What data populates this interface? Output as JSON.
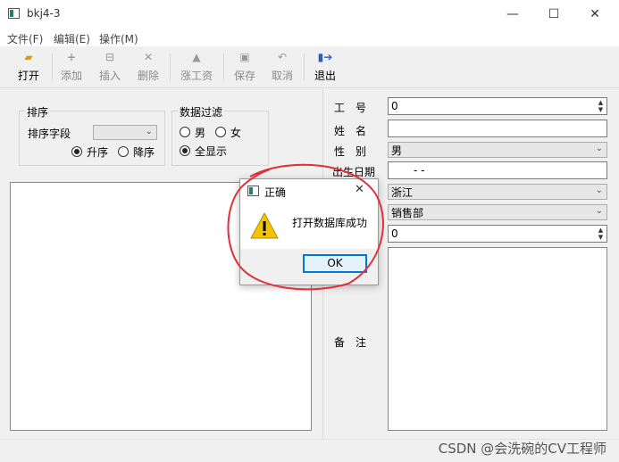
{
  "window": {
    "title": "bkj4-3",
    "minimize_glyph": "—",
    "maximize_glyph": "☐",
    "close_glyph": "✕"
  },
  "menu": [
    {
      "label": "文件(F)"
    },
    {
      "label": "编辑(E)"
    },
    {
      "label": "操作(M)"
    }
  ],
  "toolbar": {
    "open": {
      "label": "打开",
      "icon": "folder-open-icon"
    },
    "add": {
      "label": "添加",
      "icon": "plus-icon"
    },
    "insert": {
      "label": "插入",
      "icon": "insert-row-icon"
    },
    "delete": {
      "label": "删除",
      "icon": "x-icon"
    },
    "raise": {
      "label": "涨工资",
      "icon": "triangle-up-icon"
    },
    "save": {
      "label": "保存",
      "icon": "floppy-icon"
    },
    "cancel": {
      "label": "取消",
      "icon": "undo-icon"
    },
    "exit": {
      "label": "退出",
      "icon": "exit-door-icon"
    }
  },
  "sort": {
    "group_title": "排序",
    "field_label": "排序字段",
    "field_value": "",
    "asc_label": "升序",
    "desc_label": "降序",
    "selected": "asc"
  },
  "filter": {
    "group_title": "数据过滤",
    "male_label": "男",
    "female_label": "女",
    "all_label": "全显示",
    "selected": "all"
  },
  "form": {
    "emp_no_label": "工　号",
    "emp_no_value": "0",
    "name_label": "姓　名",
    "name_value": "",
    "gender_label": "性　别",
    "gender_value": "男",
    "birth_label": "出生日期",
    "birth_value": "-   -",
    "province_value": "浙江",
    "dept_value": "销售部",
    "salary_value": "0",
    "memo_label": "备　注"
  },
  "dialog": {
    "title": "正确",
    "message": "打开数据库成功",
    "ok_label": "OK",
    "icon": "warning-icon"
  },
  "watermark": "CSDN @会洗碗的CV工程师",
  "colors": {
    "annotation": "#e0303a",
    "accent": "#0078d7",
    "warning": "#f5c400"
  }
}
